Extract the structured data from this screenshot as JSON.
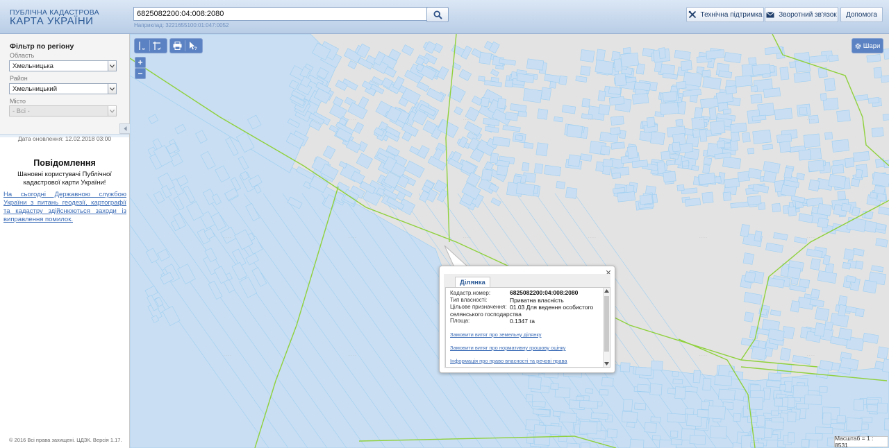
{
  "header": {
    "logo_top": "ПУБЛІЧНА КАДАСТРОВА",
    "logo_bottom": "КАРТА УКРАЇНИ",
    "search_value": "6825082200:04:008:2080",
    "search_example": "Наприклад: 3221655100:01:047:0052",
    "buttons": {
      "support": "Технічна підтримка",
      "feedback": "Зворотний зв'язок",
      "help": "Допомога"
    }
  },
  "filter": {
    "title": "Фільтр по регіону",
    "oblast_label": "Область",
    "oblast_value": "Хмельницька",
    "rayon_label": "Район",
    "rayon_value": "Хмельницький",
    "misto_label": "Місто",
    "misto_value": "- Всі -"
  },
  "sidebar": {
    "update_date": "Дата оновлення: 12.02.2018 03:00",
    "messages_title": "Повідомлення",
    "messages_text": "Шановні користувачі Публічної кадастрової карти України!",
    "messages_link": "На сьогодні Державною службою України з питань геодезії, картографії та кадастру здійснюються заходи із виправлення помилок.",
    "copyright": "© 2016 Всі права захищені. ЦДЗК. Версія 1.17."
  },
  "map": {
    "layers_label": "Шари",
    "scale_text": "Масштаб = 1 : 8531",
    "tools": [
      "ruler-m",
      "ruler-m2",
      "print",
      "identify"
    ],
    "colors": {
      "parcel": "#9ecff2",
      "parcel_fill": "#c9def2",
      "boundary": "#8fd13c",
      "background": "#e3e3e3"
    }
  },
  "popup": {
    "tab_label": "Ділянка",
    "rows": [
      {
        "label": "Кадастр.номер:",
        "value": "6825082200:04:008:2080"
      },
      {
        "label": "Тип власності:",
        "value": "Приватна власність"
      },
      {
        "label": "Цільове призначення:",
        "value": "01.03 Для ведення особистого"
      },
      {
        "label": "",
        "value": "селянського господарства"
      },
      {
        "label": "Площа:",
        "value": "0.1347 га"
      }
    ],
    "links": [
      "Замовити витяг про земельну ділянку",
      "Замовити витяг про нормативну грошову оцінку",
      "Інформація про право власності та речові права"
    ]
  }
}
